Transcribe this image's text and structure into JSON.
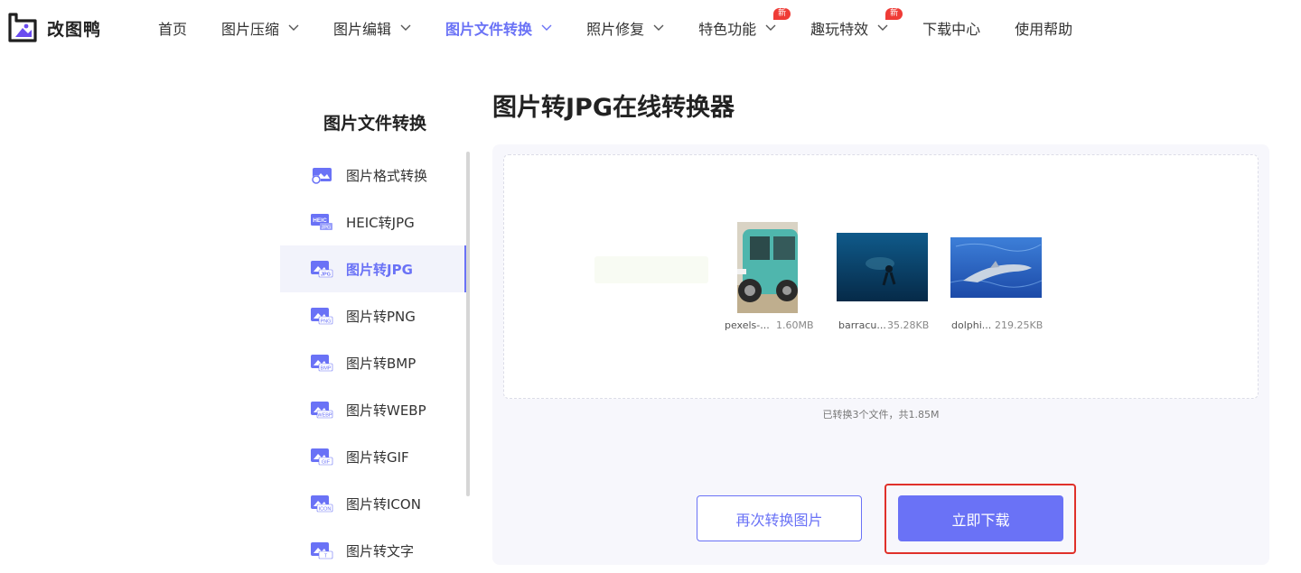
{
  "app": {
    "name": "改图鸭"
  },
  "nav": {
    "items": [
      {
        "label": "首页",
        "dropdown": false,
        "active": false,
        "badge": ""
      },
      {
        "label": "图片压缩",
        "dropdown": true,
        "active": false,
        "badge": ""
      },
      {
        "label": "图片编辑",
        "dropdown": true,
        "active": false,
        "badge": ""
      },
      {
        "label": "图片文件转换",
        "dropdown": true,
        "active": true,
        "badge": ""
      },
      {
        "label": "照片修复",
        "dropdown": true,
        "active": false,
        "badge": ""
      },
      {
        "label": "特色功能",
        "dropdown": true,
        "active": false,
        "badge": "新"
      },
      {
        "label": "趣玩特效",
        "dropdown": true,
        "active": false,
        "badge": "新"
      },
      {
        "label": "下载中心",
        "dropdown": false,
        "active": false,
        "badge": ""
      },
      {
        "label": "使用帮助",
        "dropdown": false,
        "active": false,
        "badge": ""
      }
    ]
  },
  "sidebar": {
    "title": "图片文件转换",
    "items": [
      {
        "label": "图片格式转换",
        "icon_tag": "",
        "active": false
      },
      {
        "label": "HEIC转JPG",
        "icon_tag": "HEIC",
        "active": false
      },
      {
        "label": "图片转JPG",
        "icon_tag": "JPG",
        "active": true
      },
      {
        "label": "图片转PNG",
        "icon_tag": "PNG",
        "active": false
      },
      {
        "label": "图片转BMP",
        "icon_tag": "BMP",
        "active": false
      },
      {
        "label": "图片转WEBP",
        "icon_tag": "WEBP",
        "active": false
      },
      {
        "label": "图片转GIF",
        "icon_tag": "GIF",
        "active": false
      },
      {
        "label": "图片转ICON",
        "icon_tag": "ICON",
        "active": false
      },
      {
        "label": "图片转文字",
        "icon_tag": "T",
        "active": false
      }
    ]
  },
  "main": {
    "title": "图片转JPG在线转换器",
    "files": [
      {
        "name": "pexels-...",
        "size": "1.60MB",
        "thumb": "car-photo"
      },
      {
        "name": "barracu...",
        "size": "35.28KB",
        "thumb": "diver-photo"
      },
      {
        "name": "dolphi...",
        "size": "219.25KB",
        "thumb": "dolphin-photo"
      }
    ],
    "summary": "已转换3个文件，共1.85M",
    "reconvert_label": "再次转换图片",
    "download_label": "立即下载"
  },
  "colors": {
    "accent": "#6a72f6",
    "badge": "#ef3b36",
    "highlight": "#e0312a"
  }
}
